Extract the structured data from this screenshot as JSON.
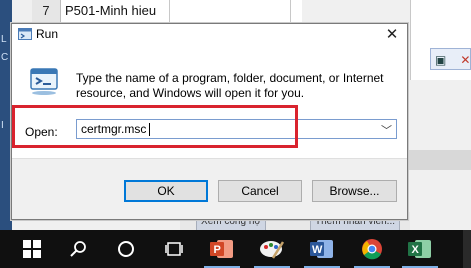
{
  "background": {
    "row_number": "7",
    "cell_text": "P501-Minh hieu",
    "tabs": [
      "Xem công nợ",
      "Thêm nhân viên..."
    ],
    "side_letters": [
      "L",
      "C",
      "I"
    ]
  },
  "dialog": {
    "title": "Run",
    "close_glyph": "✕",
    "description": "Type the name of a program, folder, document, or Internet resource, and Windows will open it for you.",
    "open_label": "Open:",
    "open_value": "certmgr.msc",
    "buttons": {
      "ok": "OK",
      "cancel": "Cancel",
      "browse": "Browse..."
    }
  },
  "taskbar": {
    "items": [
      "windows-start",
      "search",
      "cortana",
      "task-view",
      "powerpoint",
      "paint",
      "word",
      "chrome",
      "excel"
    ]
  },
  "colors": {
    "highlight": "#d9232e",
    "taskbar": "#101010",
    "accent": "#0078d7"
  }
}
